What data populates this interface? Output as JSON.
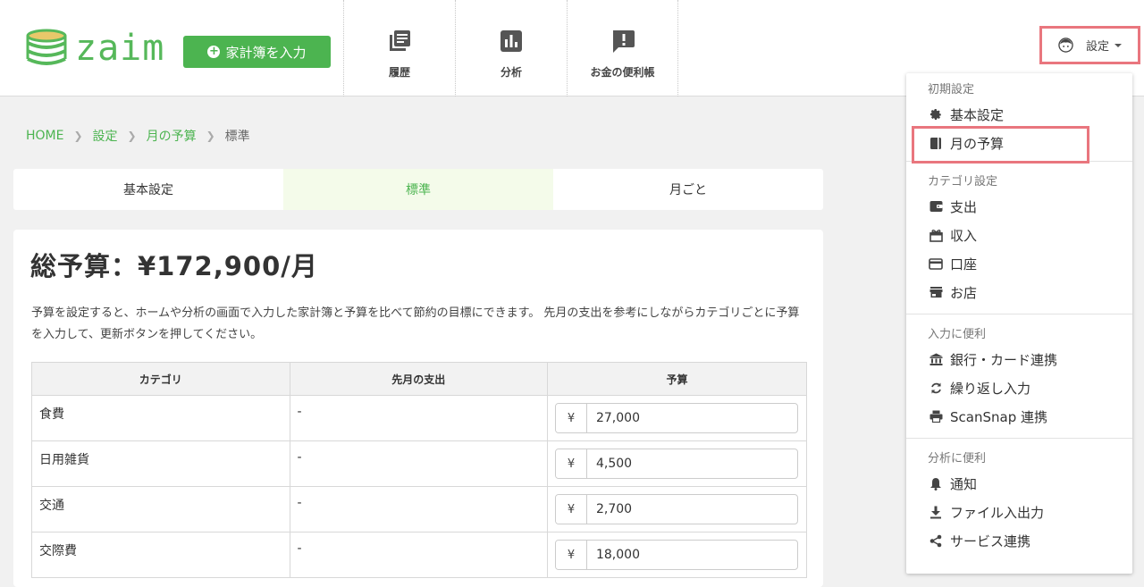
{
  "header": {
    "logo_text": "zaim",
    "add_button": "家計簿を入力",
    "nav": [
      {
        "label": "履歴",
        "icon": "history-list-icon"
      },
      {
        "label": "分析",
        "icon": "bar-chart-icon"
      },
      {
        "label": "お金の便利帳",
        "icon": "exclamation-message-icon"
      }
    ],
    "settings_label": "設定"
  },
  "breadcrumb": {
    "home": "HOME",
    "settings": "設定",
    "monthly_budget": "月の予算",
    "current": "標準"
  },
  "tabs": [
    {
      "label": "基本設定",
      "active": false
    },
    {
      "label": "標準",
      "active": true
    },
    {
      "label": "月ごと",
      "active": false
    }
  ],
  "main": {
    "total_title": "総予算：¥172,900/月",
    "description": "予算を設定すると、ホームや分析の画面で入力した家計簿と予算を比べて節約の目標にできます。 先月の支出を参考にしながらカテゴリごとに予算を入力して、更新ボタンを押してください。",
    "table": {
      "headers": [
        "カテゴリ",
        "先月の支出",
        "予算"
      ],
      "currency_symbol": "¥",
      "rows": [
        {
          "category": "食費",
          "last_month": "-",
          "budget": "27,000"
        },
        {
          "category": "日用雑貨",
          "last_month": "-",
          "budget": "4,500"
        },
        {
          "category": "交通",
          "last_month": "-",
          "budget": "2,700"
        },
        {
          "category": "交際費",
          "last_month": "-",
          "budget": "18,000"
        }
      ]
    }
  },
  "dropdown": {
    "sections": [
      {
        "header": "初期設定",
        "items": [
          {
            "label": "基本設定",
            "icon": "gear-icon"
          },
          {
            "label": "月の予算",
            "icon": "book-icon"
          }
        ]
      },
      {
        "header": "カテゴリ設定",
        "items": [
          {
            "label": "支出",
            "icon": "wallet-icon"
          },
          {
            "label": "収入",
            "icon": "gift-icon"
          },
          {
            "label": "口座",
            "icon": "credit-card-icon"
          },
          {
            "label": "お店",
            "icon": "store-icon"
          }
        ]
      },
      {
        "header": "入力に便利",
        "items": [
          {
            "label": "銀行・カード連携",
            "icon": "bank-icon"
          },
          {
            "label": "繰り返し入力",
            "icon": "repeat-icon"
          },
          {
            "label": "ScanSnap 連携",
            "icon": "printer-icon"
          }
        ]
      },
      {
        "header": "分析に便利",
        "items": [
          {
            "label": "通知",
            "icon": "bell-icon"
          },
          {
            "label": "ファイル入出力",
            "icon": "download-icon"
          },
          {
            "label": "サービス連携",
            "icon": "share-icon"
          }
        ]
      }
    ]
  },
  "colors": {
    "brand_green": "#4cb450",
    "highlight_red": "#e9767e"
  }
}
